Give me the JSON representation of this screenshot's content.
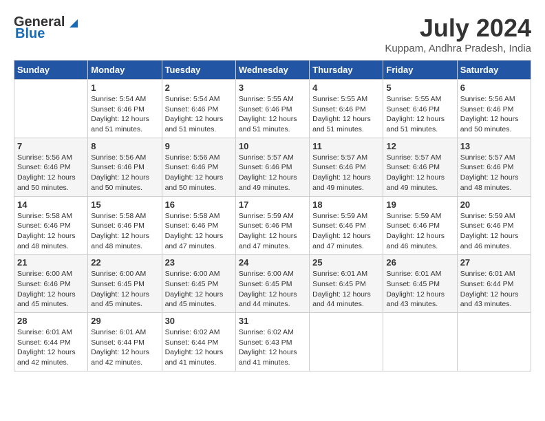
{
  "header": {
    "logo_general": "General",
    "logo_blue": "Blue",
    "title": "July 2024",
    "location": "Kuppam, Andhra Pradesh, India"
  },
  "weekdays": [
    "Sunday",
    "Monday",
    "Tuesday",
    "Wednesday",
    "Thursday",
    "Friday",
    "Saturday"
  ],
  "weeks": [
    [
      {
        "day": "",
        "content": ""
      },
      {
        "day": "1",
        "content": "Sunrise: 5:54 AM\nSunset: 6:46 PM\nDaylight: 12 hours\nand 51 minutes."
      },
      {
        "day": "2",
        "content": "Sunrise: 5:54 AM\nSunset: 6:46 PM\nDaylight: 12 hours\nand 51 minutes."
      },
      {
        "day": "3",
        "content": "Sunrise: 5:55 AM\nSunset: 6:46 PM\nDaylight: 12 hours\nand 51 minutes."
      },
      {
        "day": "4",
        "content": "Sunrise: 5:55 AM\nSunset: 6:46 PM\nDaylight: 12 hours\nand 51 minutes."
      },
      {
        "day": "5",
        "content": "Sunrise: 5:55 AM\nSunset: 6:46 PM\nDaylight: 12 hours\nand 51 minutes."
      },
      {
        "day": "6",
        "content": "Sunrise: 5:56 AM\nSunset: 6:46 PM\nDaylight: 12 hours\nand 50 minutes."
      }
    ],
    [
      {
        "day": "7",
        "content": "Sunrise: 5:56 AM\nSunset: 6:46 PM\nDaylight: 12 hours\nand 50 minutes."
      },
      {
        "day": "8",
        "content": "Sunrise: 5:56 AM\nSunset: 6:46 PM\nDaylight: 12 hours\nand 50 minutes."
      },
      {
        "day": "9",
        "content": "Sunrise: 5:56 AM\nSunset: 6:46 PM\nDaylight: 12 hours\nand 50 minutes."
      },
      {
        "day": "10",
        "content": "Sunrise: 5:57 AM\nSunset: 6:46 PM\nDaylight: 12 hours\nand 49 minutes."
      },
      {
        "day": "11",
        "content": "Sunrise: 5:57 AM\nSunset: 6:46 PM\nDaylight: 12 hours\nand 49 minutes."
      },
      {
        "day": "12",
        "content": "Sunrise: 5:57 AM\nSunset: 6:46 PM\nDaylight: 12 hours\nand 49 minutes."
      },
      {
        "day": "13",
        "content": "Sunrise: 5:57 AM\nSunset: 6:46 PM\nDaylight: 12 hours\nand 48 minutes."
      }
    ],
    [
      {
        "day": "14",
        "content": "Sunrise: 5:58 AM\nSunset: 6:46 PM\nDaylight: 12 hours\nand 48 minutes."
      },
      {
        "day": "15",
        "content": "Sunrise: 5:58 AM\nSunset: 6:46 PM\nDaylight: 12 hours\nand 48 minutes."
      },
      {
        "day": "16",
        "content": "Sunrise: 5:58 AM\nSunset: 6:46 PM\nDaylight: 12 hours\nand 47 minutes."
      },
      {
        "day": "17",
        "content": "Sunrise: 5:59 AM\nSunset: 6:46 PM\nDaylight: 12 hours\nand 47 minutes."
      },
      {
        "day": "18",
        "content": "Sunrise: 5:59 AM\nSunset: 6:46 PM\nDaylight: 12 hours\nand 47 minutes."
      },
      {
        "day": "19",
        "content": "Sunrise: 5:59 AM\nSunset: 6:46 PM\nDaylight: 12 hours\nand 46 minutes."
      },
      {
        "day": "20",
        "content": "Sunrise: 5:59 AM\nSunset: 6:46 PM\nDaylight: 12 hours\nand 46 minutes."
      }
    ],
    [
      {
        "day": "21",
        "content": "Sunrise: 6:00 AM\nSunset: 6:46 PM\nDaylight: 12 hours\nand 45 minutes."
      },
      {
        "day": "22",
        "content": "Sunrise: 6:00 AM\nSunset: 6:45 PM\nDaylight: 12 hours\nand 45 minutes."
      },
      {
        "day": "23",
        "content": "Sunrise: 6:00 AM\nSunset: 6:45 PM\nDaylight: 12 hours\nand 45 minutes."
      },
      {
        "day": "24",
        "content": "Sunrise: 6:00 AM\nSunset: 6:45 PM\nDaylight: 12 hours\nand 44 minutes."
      },
      {
        "day": "25",
        "content": "Sunrise: 6:01 AM\nSunset: 6:45 PM\nDaylight: 12 hours\nand 44 minutes."
      },
      {
        "day": "26",
        "content": "Sunrise: 6:01 AM\nSunset: 6:45 PM\nDaylight: 12 hours\nand 43 minutes."
      },
      {
        "day": "27",
        "content": "Sunrise: 6:01 AM\nSunset: 6:44 PM\nDaylight: 12 hours\nand 43 minutes."
      }
    ],
    [
      {
        "day": "28",
        "content": "Sunrise: 6:01 AM\nSunset: 6:44 PM\nDaylight: 12 hours\nand 42 minutes."
      },
      {
        "day": "29",
        "content": "Sunrise: 6:01 AM\nSunset: 6:44 PM\nDaylight: 12 hours\nand 42 minutes."
      },
      {
        "day": "30",
        "content": "Sunrise: 6:02 AM\nSunset: 6:44 PM\nDaylight: 12 hours\nand 41 minutes."
      },
      {
        "day": "31",
        "content": "Sunrise: 6:02 AM\nSunset: 6:43 PM\nDaylight: 12 hours\nand 41 minutes."
      },
      {
        "day": "",
        "content": ""
      },
      {
        "day": "",
        "content": ""
      },
      {
        "day": "",
        "content": ""
      }
    ]
  ]
}
